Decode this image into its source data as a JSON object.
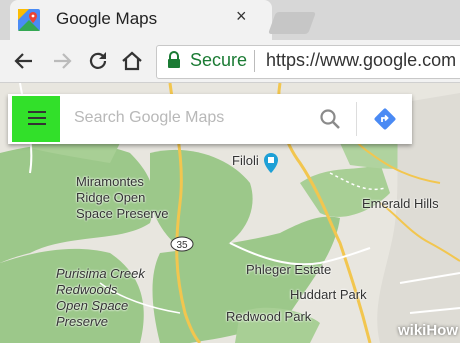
{
  "browser": {
    "tab_title": "Google Maps",
    "tab_close_glyph": "×",
    "secure_label": "Secure",
    "url": "https://www.google.com"
  },
  "maps_search": {
    "placeholder": "Search Google Maps"
  },
  "map_labels": {
    "filoli": "Filoli",
    "miramontes": [
      "Miramontes",
      "Ridge Open",
      "Space Preserve"
    ],
    "emerald_hills": "Emerald Hills",
    "route_shield": "35",
    "phleger_estate": "Phleger Estate",
    "huddart_park": "Huddart Park",
    "purisima": [
      "Purisima Creek",
      "Redwoods",
      "Open Space",
      "Preserve"
    ],
    "redwood_park": "Redwood Park"
  },
  "watermark": "wikiHow",
  "colors": {
    "highlight": "#32e02a",
    "park_green": "#9cc88a",
    "land_gray": "#e8e6df",
    "road_yellow": "#f2c64f"
  }
}
